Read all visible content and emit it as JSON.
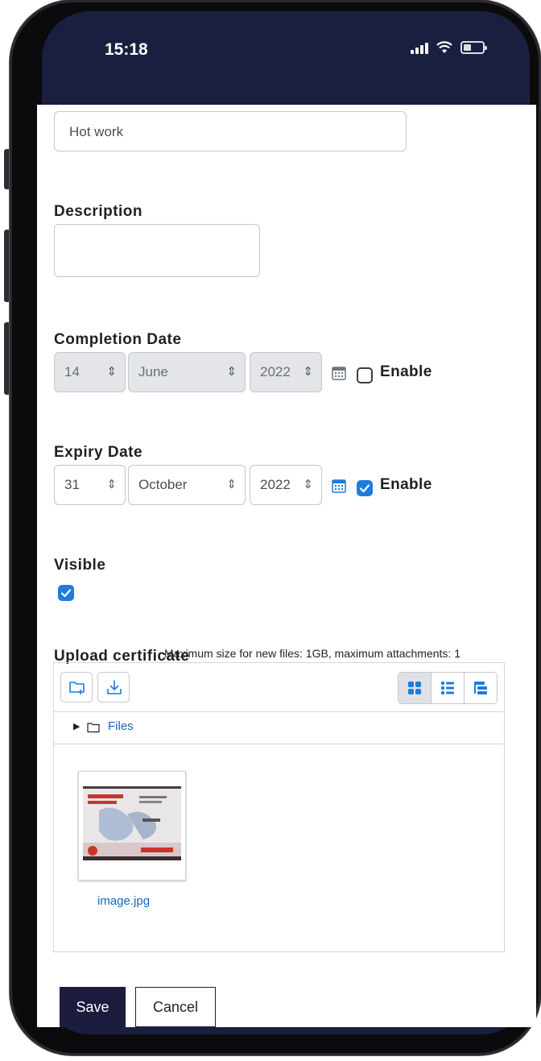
{
  "status_bar": {
    "time": "15:18"
  },
  "form": {
    "name_value": "Hot work",
    "description_label": "Description",
    "description_value": "",
    "completion_date": {
      "label": "Completion Date",
      "day": "14",
      "month": "June",
      "year": "2022",
      "enable_label": "Enable",
      "enabled": false
    },
    "expiry_date": {
      "label": "Expiry Date",
      "day": "31",
      "month": "October",
      "year": "2022",
      "enable_label": "Enable",
      "enabled": true
    },
    "visible": {
      "label": "Visible",
      "checked": true
    },
    "upload": {
      "label": "Upload certificate",
      "limits": "Maximum size for new files: 1GB, maximum attachments: 1",
      "path_label": "Files",
      "files": [
        {
          "name": "image.jpg"
        }
      ]
    }
  },
  "actions": {
    "save_label": "Save",
    "cancel_label": "Cancel"
  },
  "colors": {
    "accent": "#1f7bde",
    "primary_button": "#1b1c3e",
    "link": "#1565c0"
  }
}
